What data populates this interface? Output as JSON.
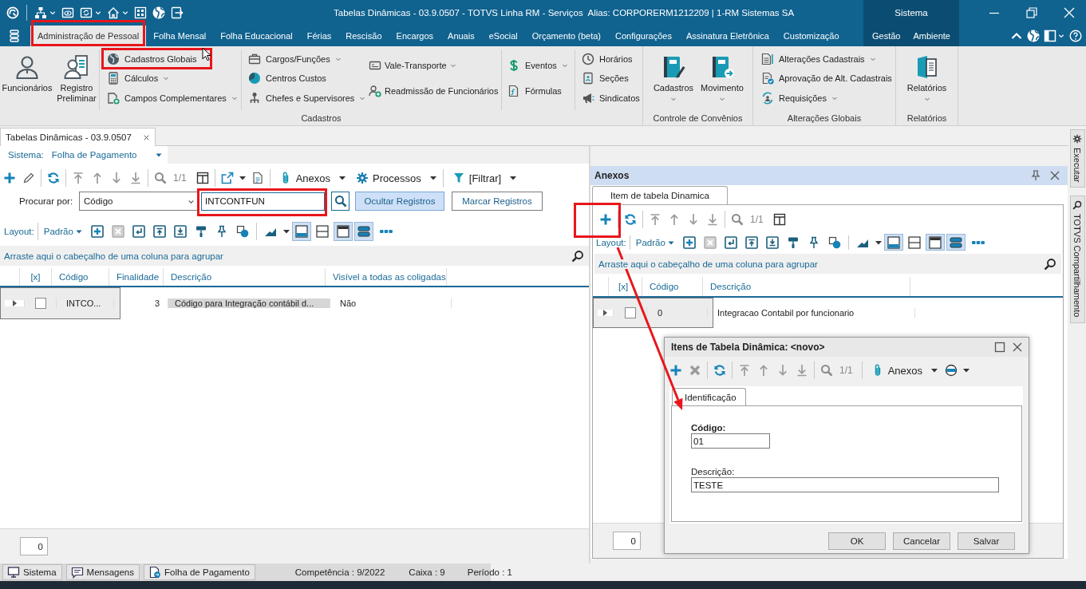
{
  "title_bar": {
    "title": "Tabelas Dinâmicas - 03.9.0507 - TOTVS Linha RM - Serviços  Alias: CORPORERM1212209 | 1-RM Sistemas SA",
    "system_label": "Sistema"
  },
  "menu_tabs": [
    {
      "label": "Administração de Pessoal",
      "selected": true
    },
    {
      "label": "Folha Mensal",
      "selected": false
    },
    {
      "label": "Folha Educacional",
      "selected": false
    },
    {
      "label": "Férias",
      "selected": false
    },
    {
      "label": "Rescisão",
      "selected": false
    },
    {
      "label": "Encargos",
      "selected": false
    },
    {
      "label": "Anuais",
      "selected": false
    },
    {
      "label": "eSocial",
      "selected": false
    },
    {
      "label": "Orçamento (beta)",
      "selected": false
    },
    {
      "label": "Configurações",
      "selected": false
    },
    {
      "label": "Assinatura Eletrônica",
      "selected": false
    },
    {
      "label": "Customização",
      "selected": false
    }
  ],
  "system_tabs": [
    {
      "label": "Gestão",
      "selected": false
    },
    {
      "label": "Ambiente",
      "selected": false
    }
  ],
  "ribbon": [
    {
      "title": "Cadastros",
      "large_buttons": [
        {
          "label": "Funcionários",
          "dropdown": false
        },
        {
          "label": "Registro Preliminar",
          "dropdown": false
        }
      ],
      "columns": [
        [
          {
            "label": "Cadastros Globais",
            "dropdown": false
          },
          {
            "label": "Cálculos",
            "dropdown": true
          },
          {
            "label": "Campos Complementares",
            "dropdown": true
          }
        ],
        [
          {
            "label": "Cargos/Funções",
            "dropdown": true
          },
          {
            "label": "Centros Custos",
            "dropdown": false
          },
          {
            "label": "Chefes e Supervisores",
            "dropdown": true
          }
        ],
        [
          {
            "label": "Vale-Transporte",
            "dropdown": true
          },
          {
            "label": "Readmissão de Funcionários",
            "dropdown": false
          }
        ],
        [
          {
            "label": "Eventos",
            "dropdown": true
          },
          {
            "label": "Fórmulas",
            "dropdown": false
          }
        ],
        [
          {
            "label": "Horários",
            "dropdown": false
          },
          {
            "label": "Seções",
            "dropdown": false
          },
          {
            "label": "Sindicatos",
            "dropdown": false
          }
        ]
      ]
    },
    {
      "title": "Controle de Convênios",
      "large_buttons": [
        {
          "label": "Cadastros",
          "dropdown": true
        },
        {
          "label": "Movimento",
          "dropdown": true
        }
      ]
    },
    {
      "title": "Alterações Globais",
      "columns": [
        [
          {
            "label": "Alterações Cadastrais",
            "dropdown": true
          },
          {
            "label": "Aprovação de Alt. Cadastrais",
            "dropdown": false
          },
          {
            "label": "Requisições",
            "dropdown": true
          }
        ]
      ]
    },
    {
      "title": "Relatórios",
      "large_buttons": [
        {
          "label": "Relatórios",
          "dropdown": true
        }
      ]
    }
  ],
  "document_tabs": [
    {
      "label": "Tabelas Dinâmicas - 03.9.0507",
      "selected": true
    }
  ],
  "system_filter": {
    "label": "Sistema:",
    "value": "Folha de Pagamento"
  },
  "toolbar": {
    "pager": "1/1",
    "menus": [
      {
        "label": "Anexos"
      },
      {
        "label": "Processos"
      },
      {
        "label": "[Filtrar]"
      }
    ]
  },
  "search": {
    "label": "Procurar por:",
    "field": "Código",
    "value": "INTCONTFUN",
    "buttons": [
      {
        "label": "Ocultar Registros",
        "selected": true
      },
      {
        "label": "Marcar Registros",
        "selected": false
      }
    ]
  },
  "layout_bar": {
    "label": "Layout:",
    "preset": "Padrão",
    "view_toggles": [
      {
        "on": true
      },
      {
        "on": false
      },
      {
        "on": true
      },
      {
        "on": true
      }
    ]
  },
  "group_hint": "Arraste aqui o cabeçalho de uma coluna para agrupar",
  "grid": {
    "columns": [
      "[x]",
      "Código",
      "Finalidade",
      "Descrição",
      "Visível a todas as coligadas"
    ],
    "rows": [
      {
        "selected": true,
        "cells": [
          {
            "kind": "checkbox",
            "checked": false
          },
          {
            "kind": "text",
            "text": "INTCO...",
            "focused": false
          },
          {
            "kind": "text",
            "text": "3",
            "focused": false
          },
          {
            "kind": "text",
            "text": "Código para Integração contábil d...",
            "focused": true
          },
          {
            "kind": "text",
            "text": "Não",
            "focused": false
          }
        ]
      }
    ]
  },
  "record_count": "0",
  "attachments_panel": {
    "title": "Anexos",
    "tabs": [
      {
        "label": "Item de tabela Dinamica",
        "selected": true
      }
    ],
    "toolbar": {
      "pager": "1/1"
    },
    "layout_bar": {
      "label": "Layout:",
      "preset": "Padrão",
      "view_toggles": [
        {
          "on": true
        },
        {
          "on": false
        },
        {
          "on": true
        },
        {
          "on": true
        }
      ]
    },
    "group_hint": "Arraste aqui o cabeçalho de uma coluna para agrupar",
    "grid": {
      "columns": [
        "[x]",
        "Código",
        "Descrição"
      ],
      "rows": [
        {
          "selected": true,
          "cells": [
            {
              "kind": "checkbox",
              "checked": false
            },
            {
              "kind": "text",
              "text": "0",
              "focused": false
            },
            {
              "kind": "text",
              "text": "Integracao Contabil por funcionario",
              "focused": false
            }
          ]
        }
      ]
    },
    "record_count": "0"
  },
  "dialog": {
    "title": "Itens de Tabela Dinâmica: <novo>",
    "toolbar": {
      "pager": "1/1",
      "menus": [
        {
          "label": "Anexos"
        }
      ]
    },
    "tabs": [
      {
        "label": "Identificação",
        "selected": true
      }
    ],
    "fields": [
      {
        "label": "Código:",
        "value": "01",
        "required": true,
        "kind": "short"
      },
      {
        "label": "Descrição:",
        "value": "TESTE",
        "required": false,
        "kind": "long"
      }
    ],
    "buttons": [
      "OK",
      "Cancelar",
      "Salvar"
    ]
  },
  "side_tabs": [
    "Executar",
    "TOTVS Compartilhamento"
  ],
  "status_bar": {
    "panels": [
      "Sistema",
      "Mensagens",
      "Folha de Pagamento"
    ],
    "info": [
      "Competência : 9/2022",
      "Caixa : 9",
      "Período : 1"
    ]
  }
}
